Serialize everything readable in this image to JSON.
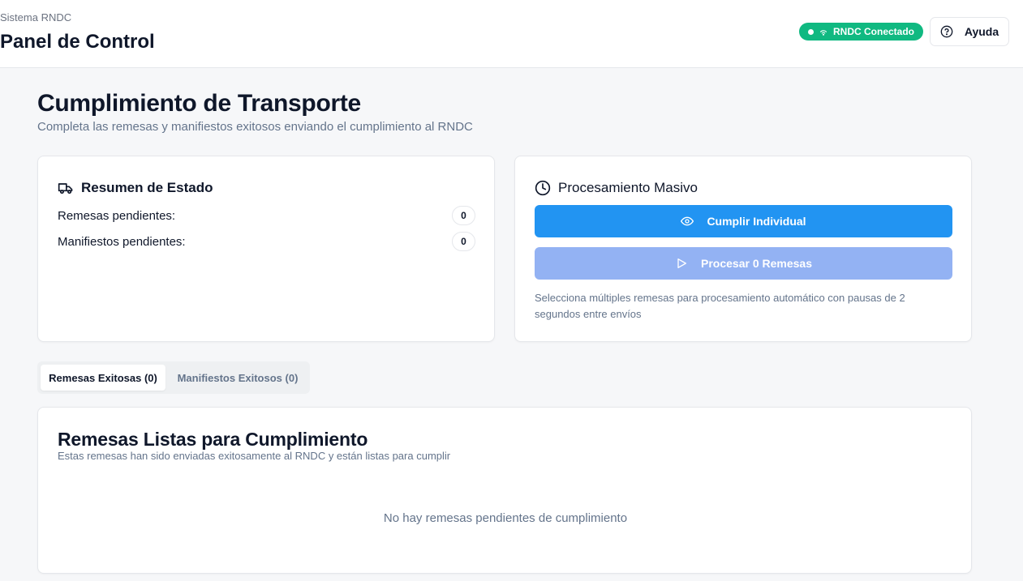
{
  "header": {
    "app_name": "Sistema RNDC",
    "title": "Panel de Control",
    "status_badge": "RNDC Conectado",
    "help_label": "Ayuda"
  },
  "page": {
    "heading": "Cumplimiento de Transporte",
    "subheading": "Completa las remesas y manifiestos exitosos enviando el cumplimiento al RNDC"
  },
  "status_card": {
    "title": "Resumen de Estado",
    "rows": [
      {
        "label": "Remesas pendientes:",
        "count": "0"
      },
      {
        "label": "Manifiestos pendientes:",
        "count": "0"
      }
    ]
  },
  "bulk_card": {
    "title": "Procesamiento Masivo",
    "individual_button": "Cumplir Individual",
    "process_button": "Procesar 0 Remesas",
    "note": "Selecciona múltiples remesas para procesamiento automático con pausas de 2 segundos entre envíos"
  },
  "tabs": [
    {
      "label": "Remesas Exitosas (0)",
      "active": true
    },
    {
      "label": "Manifiestos Exitosos (0)",
      "active": false
    }
  ],
  "list_card": {
    "title": "Remesas Listas para Cumplimiento",
    "subtitle": "Estas remesas han sido enviadas exitosamente al RNDC y están listas para cumplir",
    "empty_message": "No hay remesas pendientes de cumplimiento"
  },
  "colors": {
    "connected_badge": "#10b981",
    "primary_button": "#2294f2",
    "disabled_button": "#93b2f3"
  },
  "icons": {
    "status_card": "truck-icon",
    "bulk_card": "clock-icon",
    "individual_button": "eye-icon",
    "process_button": "play-icon",
    "help": "help-circle-icon",
    "badge": "wifi-icon"
  }
}
